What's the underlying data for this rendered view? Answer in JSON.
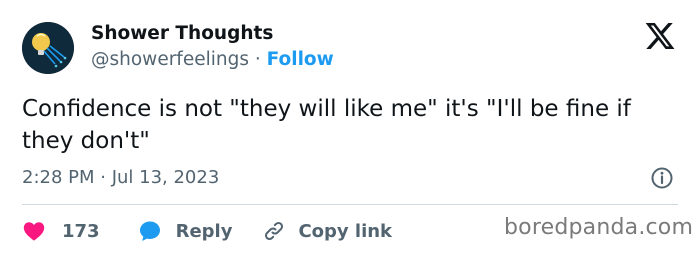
{
  "author": {
    "display_name": "Shower Thoughts",
    "handle": "@showerfeelings",
    "separator": "·",
    "follow_label": "Follow",
    "avatar_icon": "lightbulb-shower-icon"
  },
  "brand": {
    "logo_icon": "x-logo-icon"
  },
  "tweet": {
    "text": "Confidence is not \"they will like me\" it's \"I'll be fine if they don't\"",
    "timestamp": "2:28 PM · Jul 13, 2023",
    "info_icon": "info-icon"
  },
  "actions": {
    "like_count": "173",
    "reply_label": "Reply",
    "copy_link_label": "Copy link"
  },
  "watermark": "boredpanda.com",
  "colors": {
    "accent": "#1d9bf0",
    "like": "#f91880",
    "text": "#0f1419",
    "muted": "#536471",
    "divider": "#cfd9de"
  }
}
